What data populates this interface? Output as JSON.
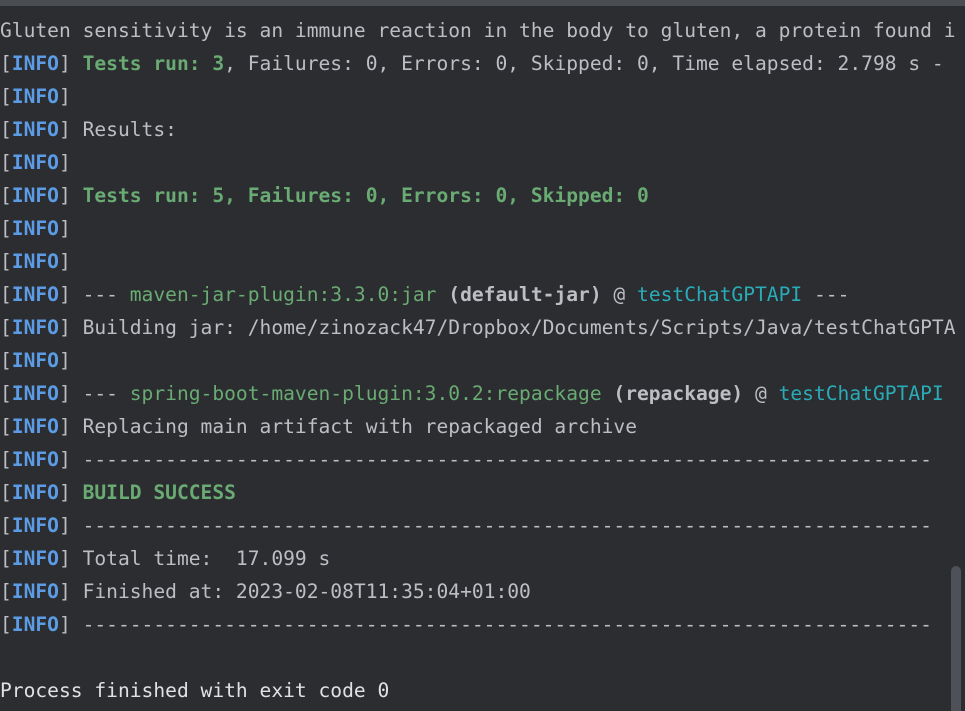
{
  "console": {
    "tag_prefix": "[",
    "tag_level": "INFO",
    "tag_suffix": "] ",
    "line0": "Gluten sensitivity is an immune reaction in the body to gluten, a protein found i",
    "line1": {
      "tests_run_label": "Tests run: ",
      "tests_run_value": "3",
      "rest": ", Failures: 0, Errors: 0, Skipped: 0, Time elapsed: 2.798 s - "
    },
    "line3": "Results:",
    "line5": "Tests run: 5, Failures: 0, Errors: 0, Skipped: 0",
    "line8": {
      "dashes_open": "--- ",
      "plugin": "maven-jar-plugin:3.3.0:jar",
      "goal": " (default-jar)",
      "at": " @ ",
      "project": "testChatGPTAPI",
      "dashes_close": " ---"
    },
    "line9": "Building jar: /home/zinozack47/Dropbox/Documents/Scripts/Java/testChatGPTA",
    "line11": {
      "dashes_open": "--- ",
      "plugin": "spring-boot-maven-plugin:3.0.2:repackage",
      "goal": " (repackage)",
      "at": " @ ",
      "project": "testChatGPTAPI"
    },
    "line12": "Replacing main artifact with repackaged archive",
    "separator": "------------------------------------------------------------------------",
    "build_status": "BUILD SUCCESS",
    "total_time": "Total time:  17.099 s",
    "finished_at": "Finished at: 2023-02-08T11:35:04+01:00",
    "exit_message": "Process finished with exit code 0"
  },
  "colors": {
    "background": "#2b2d30",
    "info_tag": "#5c9ce6",
    "success_green": "#6aab73",
    "project_cyan": "#2aacb8",
    "text": "#bcbec4"
  }
}
